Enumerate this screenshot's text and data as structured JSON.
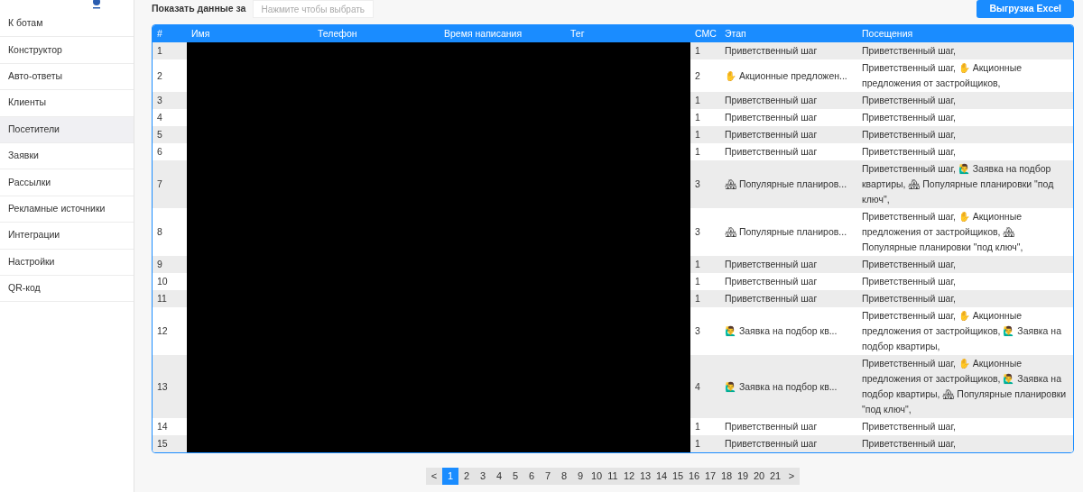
{
  "sidebar": {
    "items": [
      {
        "label": "К ботам",
        "selected": false
      },
      {
        "label": "Конструктор",
        "selected": false
      },
      {
        "label": "Авто-ответы",
        "selected": false
      },
      {
        "label": "Клиенты",
        "selected": false
      },
      {
        "label": "Посетители",
        "selected": true
      },
      {
        "label": "Заявки",
        "selected": false
      },
      {
        "label": "Рассылки",
        "selected": false
      },
      {
        "label": "Рекламные источники",
        "selected": false
      },
      {
        "label": "Интеграции",
        "selected": false
      },
      {
        "label": "Настройки",
        "selected": false
      },
      {
        "label": "QR-код",
        "selected": false
      }
    ]
  },
  "filter": {
    "label": "Показать данные за",
    "placeholder": "Нажмите чтобы выбрать"
  },
  "export_button": "Выгрузка Excel",
  "table": {
    "redacted": true,
    "columns": [
      "#",
      "Имя",
      "Телефон",
      "Время написания",
      "Тег",
      "СМС",
      "Этап",
      "Посещения"
    ],
    "rows": [
      {
        "number": "1",
        "sms": "1",
        "stage": "Приветственный шаг",
        "visits": "Приветственный шаг,"
      },
      {
        "number": "2",
        "sms": "2",
        "stage": "✋ Акционные предложен...",
        "visits": "Приветственный шаг, ✋ Акционные предложения от застройщиков,"
      },
      {
        "number": "3",
        "sms": "1",
        "stage": "Приветственный шаг",
        "visits": "Приветственный шаг,"
      },
      {
        "number": "4",
        "sms": "1",
        "stage": "Приветственный шаг",
        "visits": "Приветственный шаг,"
      },
      {
        "number": "5",
        "sms": "1",
        "stage": "Приветственный шаг",
        "visits": "Приветственный шаг,"
      },
      {
        "number": "6",
        "sms": "1",
        "stage": "Приветственный шаг",
        "visits": "Приветственный шаг,"
      },
      {
        "number": "7",
        "sms": "3",
        "stage": "🏘 Популярные планиров...",
        "visits": "Приветственный шаг, 🙋‍♂ Заявка на подбор квартиры, 🏘 Популярные планировки \"под ключ\","
      },
      {
        "number": "8",
        "sms": "3",
        "stage": "🏘 Популярные планиров...",
        "visits": "Приветственный шаг, ✋ Акционные предложения от застройщиков, 🏘 Популярные планировки \"под ключ\","
      },
      {
        "number": "9",
        "sms": "1",
        "stage": "Приветственный шаг",
        "visits": "Приветственный шаг,"
      },
      {
        "number": "10",
        "sms": "1",
        "stage": "Приветственный шаг",
        "visits": "Приветственный шаг,"
      },
      {
        "number": "11",
        "sms": "1",
        "stage": "Приветственный шаг",
        "visits": "Приветственный шаг,"
      },
      {
        "number": "12",
        "sms": "3",
        "stage": "🙋‍♂ Заявка на подбор кв...",
        "visits": "Приветственный шаг, ✋ Акционные предложения от застройщиков, 🙋‍♂ Заявка на подбор квартиры,"
      },
      {
        "number": "13",
        "sms": "4",
        "stage": "🙋‍♂ Заявка на подбор кв...",
        "visits": "Приветственный шаг, ✋ Акционные предложения от застройщиков, 🙋‍♂ Заявка на подбор квартиры, 🏘 Популярные планировки \"под ключ\","
      },
      {
        "number": "14",
        "sms": "1",
        "stage": "Приветственный шаг",
        "visits": "Приветственный шаг,"
      },
      {
        "number": "15",
        "sms": "1",
        "stage": "Приветственный шаг",
        "visits": "Приветственный шаг,"
      }
    ]
  },
  "pagination": {
    "prev": "<",
    "next": ">",
    "pages": [
      {
        "label": "1",
        "selected": true
      },
      {
        "label": "2",
        "selected": false
      },
      {
        "label": "3",
        "selected": false
      },
      {
        "label": "4",
        "selected": false
      },
      {
        "label": "5",
        "selected": false
      },
      {
        "label": "6",
        "selected": false
      },
      {
        "label": "7",
        "selected": false
      },
      {
        "label": "8",
        "selected": false
      },
      {
        "label": "9",
        "selected": false
      },
      {
        "label": "10",
        "selected": false
      },
      {
        "label": "11",
        "selected": false
      },
      {
        "label": "12",
        "selected": false
      },
      {
        "label": "13",
        "selected": false
      },
      {
        "label": "14",
        "selected": false
      },
      {
        "label": "15",
        "selected": false
      },
      {
        "label": "16",
        "selected": false
      },
      {
        "label": "17",
        "selected": false
      },
      {
        "label": "18",
        "selected": false
      },
      {
        "label": "19",
        "selected": false
      },
      {
        "label": "20",
        "selected": false
      },
      {
        "label": "21",
        "selected": false
      }
    ]
  }
}
